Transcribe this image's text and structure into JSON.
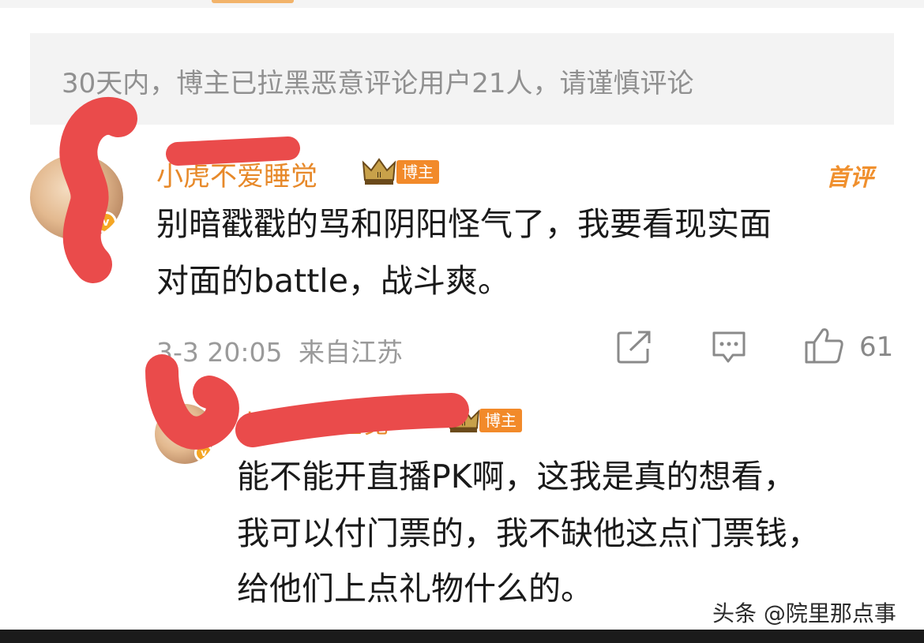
{
  "notice": {
    "text": "30天内，博主已拉黑恶意评论用户21人，请谨慎评论"
  },
  "comment": {
    "username": "小虎不爱睡觉",
    "author_badge": "博主",
    "first_tag": "首评",
    "content_line1": "别暗戳戳的骂和阴阳怪气了，我要看现实面",
    "content_line2": "对面的battle，战斗爽。",
    "time": "3-3 20:05",
    "location": "来自江苏",
    "like_count": "61",
    "icons": [
      "share-icon",
      "comment-icon",
      "like-icon"
    ]
  },
  "reply": {
    "username": "小虎不爱睡觉",
    "author_badge": "博主",
    "content_line1": "能不能开直播PK啊，这我是真的想看，",
    "content_line2": "我可以付门票的，我不缺他这点门票钱，",
    "content_line3": "给他们上点礼物什么的。"
  },
  "watermark": "头条 @院里那点事",
  "colors": {
    "username": "#e7892a",
    "badge": "#f28a2a",
    "redaction": "#ea4b4b",
    "notice_bg": "#f3f3f3"
  }
}
